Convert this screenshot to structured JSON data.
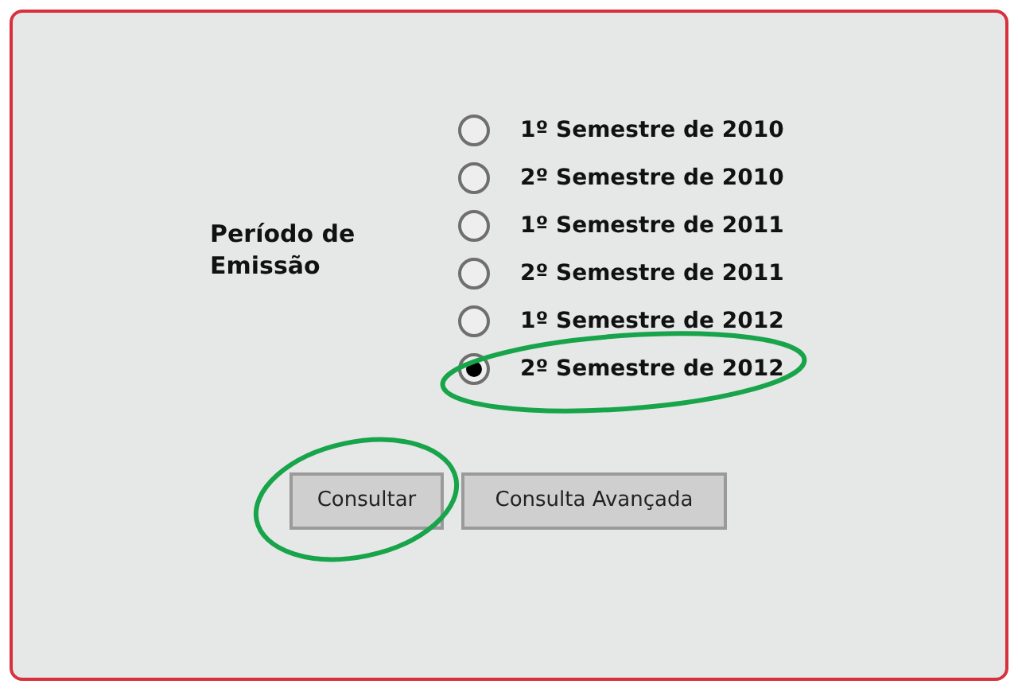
{
  "field_label": "Período de Emissão",
  "options": [
    {
      "label": "1º Semestre de 2010",
      "selected": false
    },
    {
      "label": "2º Semestre de 2010",
      "selected": false
    },
    {
      "label": "1º Semestre de 2011",
      "selected": false
    },
    {
      "label": "2º Semestre de 2011",
      "selected": false
    },
    {
      "label": "1º Semestre de 2012",
      "selected": false
    },
    {
      "label": "2º Semestre de 2012",
      "selected": true
    }
  ],
  "buttons": [
    "Consultar",
    "Consulta Avançada"
  ]
}
